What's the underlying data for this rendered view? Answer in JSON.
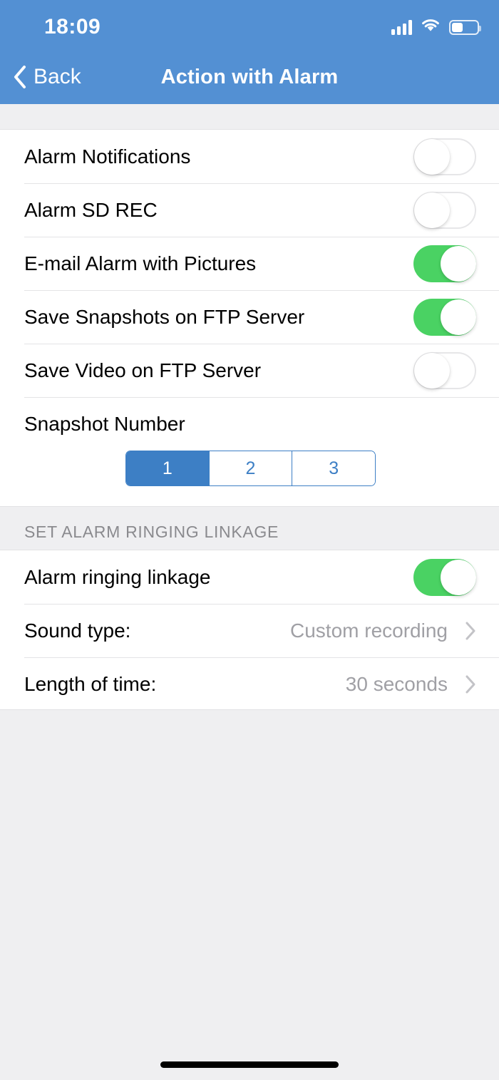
{
  "status_bar": {
    "time": "18:09",
    "signal_icon": "cellular-signal-icon",
    "wifi_icon": "wifi-icon",
    "battery_icon": "battery-icon",
    "battery_level_percent": 40
  },
  "nav": {
    "back_label": "Back",
    "back_icon": "chevron-left-icon",
    "title": "Action with Alarm"
  },
  "colors": {
    "header_blue": "#5390d3",
    "accent_blue": "#3d7fc5",
    "toggle_on_green": "#4ad263",
    "page_background": "#efeff1",
    "row_background": "#ffffff",
    "divider": "#e4e4e6",
    "value_text": "#a0a0a5",
    "section_header_text": "#8a8a8e"
  },
  "main": {
    "group1": {
      "rows": [
        {
          "label": "Alarm Notifications",
          "control": "toggle",
          "state": "off"
        },
        {
          "label": "Alarm SD REC",
          "control": "toggle",
          "state": "off"
        },
        {
          "label": "E-mail Alarm with Pictures",
          "control": "toggle",
          "state": "on"
        },
        {
          "label": "Save Snapshots on FTP Server",
          "control": "toggle",
          "state": "on"
        },
        {
          "label": "Save Video on FTP Server",
          "control": "toggle",
          "state": "off"
        },
        {
          "label": "Snapshot Number",
          "control": "segmented",
          "state": ""
        }
      ],
      "snapshot_number": {
        "options": [
          "1",
          "2",
          "3"
        ],
        "selected_index": 0,
        "selected_value": "1"
      }
    },
    "section2": {
      "header": "SET ALARM RINGING LINKAGE",
      "rows": [
        {
          "label": "Alarm ringing linkage",
          "control": "toggle",
          "state": "on",
          "value": ""
        },
        {
          "label": "Sound type:",
          "control": "disclosure",
          "state": "",
          "value": "Custom recording"
        },
        {
          "label": "Length of time:",
          "control": "disclosure",
          "state": "",
          "value": "30 seconds"
        }
      ],
      "disclosure_icon": "chevron-right-icon"
    }
  },
  "home_indicator": {
    "name": "home-indicator"
  }
}
